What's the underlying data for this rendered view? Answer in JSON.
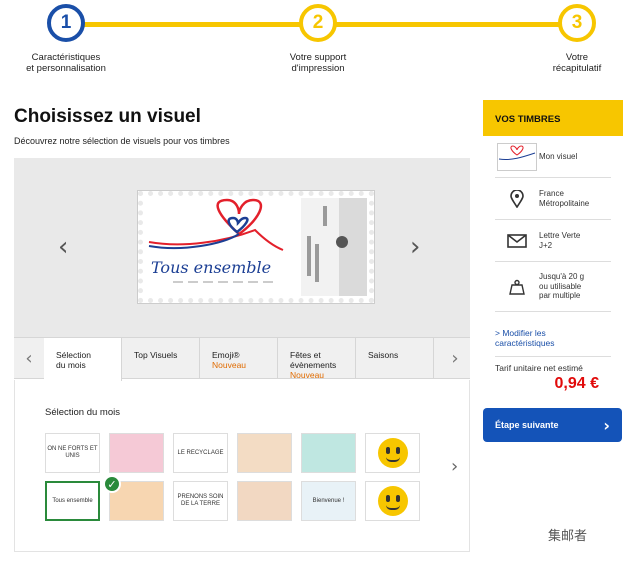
{
  "stepper": {
    "steps": [
      {
        "num": "1",
        "label": "Caractéristiques\net personnalisation"
      },
      {
        "num": "2",
        "label": "Votre support\nd'impression"
      },
      {
        "num": "3",
        "label": "Votre\nrécapitulatif"
      }
    ]
  },
  "main": {
    "title": "Choisissez un visuel",
    "subtitle": "Découvrez notre sélection de visuels pour vos timbres",
    "stamp_text": "Tous ensemble"
  },
  "tabs": [
    {
      "label": "Sélection\ndu mois",
      "badge": ""
    },
    {
      "label": "Top Visuels",
      "badge": ""
    },
    {
      "label": "Emoji®",
      "badge": "Nouveau"
    },
    {
      "label": "Fêtes et\névènements",
      "badge": "Nouveau"
    },
    {
      "label": "Saisons",
      "badge": ""
    }
  ],
  "panel": {
    "title": "Sélection du mois",
    "thumbs": [
      {
        "text": "ON NE FORTS ET UNIS",
        "bg": "#ffffff"
      },
      {
        "text": "",
        "bg": "#f5c9d6"
      },
      {
        "text": "LE RECYCLAGE",
        "bg": "#ffffff"
      },
      {
        "text": "",
        "bg": "#f3dcc4"
      },
      {
        "text": "",
        "bg": "#bfe7e1"
      },
      {
        "text": "",
        "bg": "#ffffff"
      },
      {
        "text": "Tous ensemble",
        "bg": "#ffffff"
      },
      {
        "text": "",
        "bg": "#f7d6b1"
      },
      {
        "text": "PRENONS SOIN DE LA TERRE",
        "bg": "#ffffff"
      },
      {
        "text": "",
        "bg": "#f2d8c2"
      },
      {
        "text": "Bienvenue !",
        "bg": "#e8f2f7"
      },
      {
        "text": "",
        "bg": "#ffffff"
      }
    ]
  },
  "sidebar": {
    "title": "VOS TIMBRES",
    "rows": [
      {
        "icon": "stamp-thumbnail-icon",
        "text": "Mon visuel"
      },
      {
        "icon": "location-pin-icon",
        "text": "France\nMétropolitaine"
      },
      {
        "icon": "envelope-icon",
        "text": "Lettre Verte\nJ+2"
      },
      {
        "icon": "weight-icon",
        "text": "Jusqu'à 20 g\nou utilisable\npar multiple"
      }
    ],
    "modify_link": "> Modifier les\ncaractéristiques",
    "tarif_label": "Tarif unitaire net estimé",
    "price": "0,94 €",
    "next_button": "Étape suivante"
  },
  "watermark": "集邮者",
  "colors": {
    "accent": "#f7c600",
    "primary": "#1453b8",
    "price": "#e10a0a",
    "selected": "#2a8a3b"
  }
}
